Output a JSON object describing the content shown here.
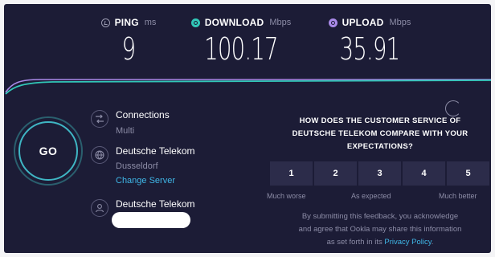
{
  "metrics": {
    "ping": {
      "label": "PING",
      "unit": "ms",
      "value": "9",
      "icon": "ping-icon"
    },
    "download": {
      "label": "DOWNLOAD",
      "unit": "Mbps",
      "value": "100.17",
      "icon": "download-icon",
      "color": "#31c7b8"
    },
    "upload": {
      "label": "UPLOAD",
      "unit": "Mbps",
      "value": "35.91",
      "icon": "upload-icon",
      "color": "#a98ae8"
    }
  },
  "go_button": {
    "label": "GO"
  },
  "connections": {
    "title": "Connections",
    "subtitle": "Multi",
    "icon": "connections-icon"
  },
  "server": {
    "name": "Deutsche Telekom",
    "location": "Dusseldorf",
    "change_label": "Change Server",
    "icon": "globe-icon"
  },
  "provider": {
    "name": "Deutsche Telekom",
    "icon": "user-icon"
  },
  "survey": {
    "question_line1": "HOW DOES THE CUSTOMER SERVICE OF",
    "question_line2": "DEUTSCHE TELEKOM COMPARE WITH YOUR",
    "question_line3": "EXPECTATIONS?",
    "ratings": [
      "1",
      "2",
      "3",
      "4",
      "5"
    ],
    "scale_low": "Much worse",
    "scale_mid": "As expected",
    "scale_high": "Much better",
    "disclaimer_line1": "By submitting this feedback, you acknowledge",
    "disclaimer_line2": "and agree that Ookla may share this information",
    "disclaimer_line3_pre": "as set forth in its",
    "privacy_link": "Privacy Policy",
    "disclaimer_end": "."
  },
  "colors": {
    "background": "#1c1c36",
    "accent": "#3fb6c4",
    "link": "#3fb6e6"
  }
}
